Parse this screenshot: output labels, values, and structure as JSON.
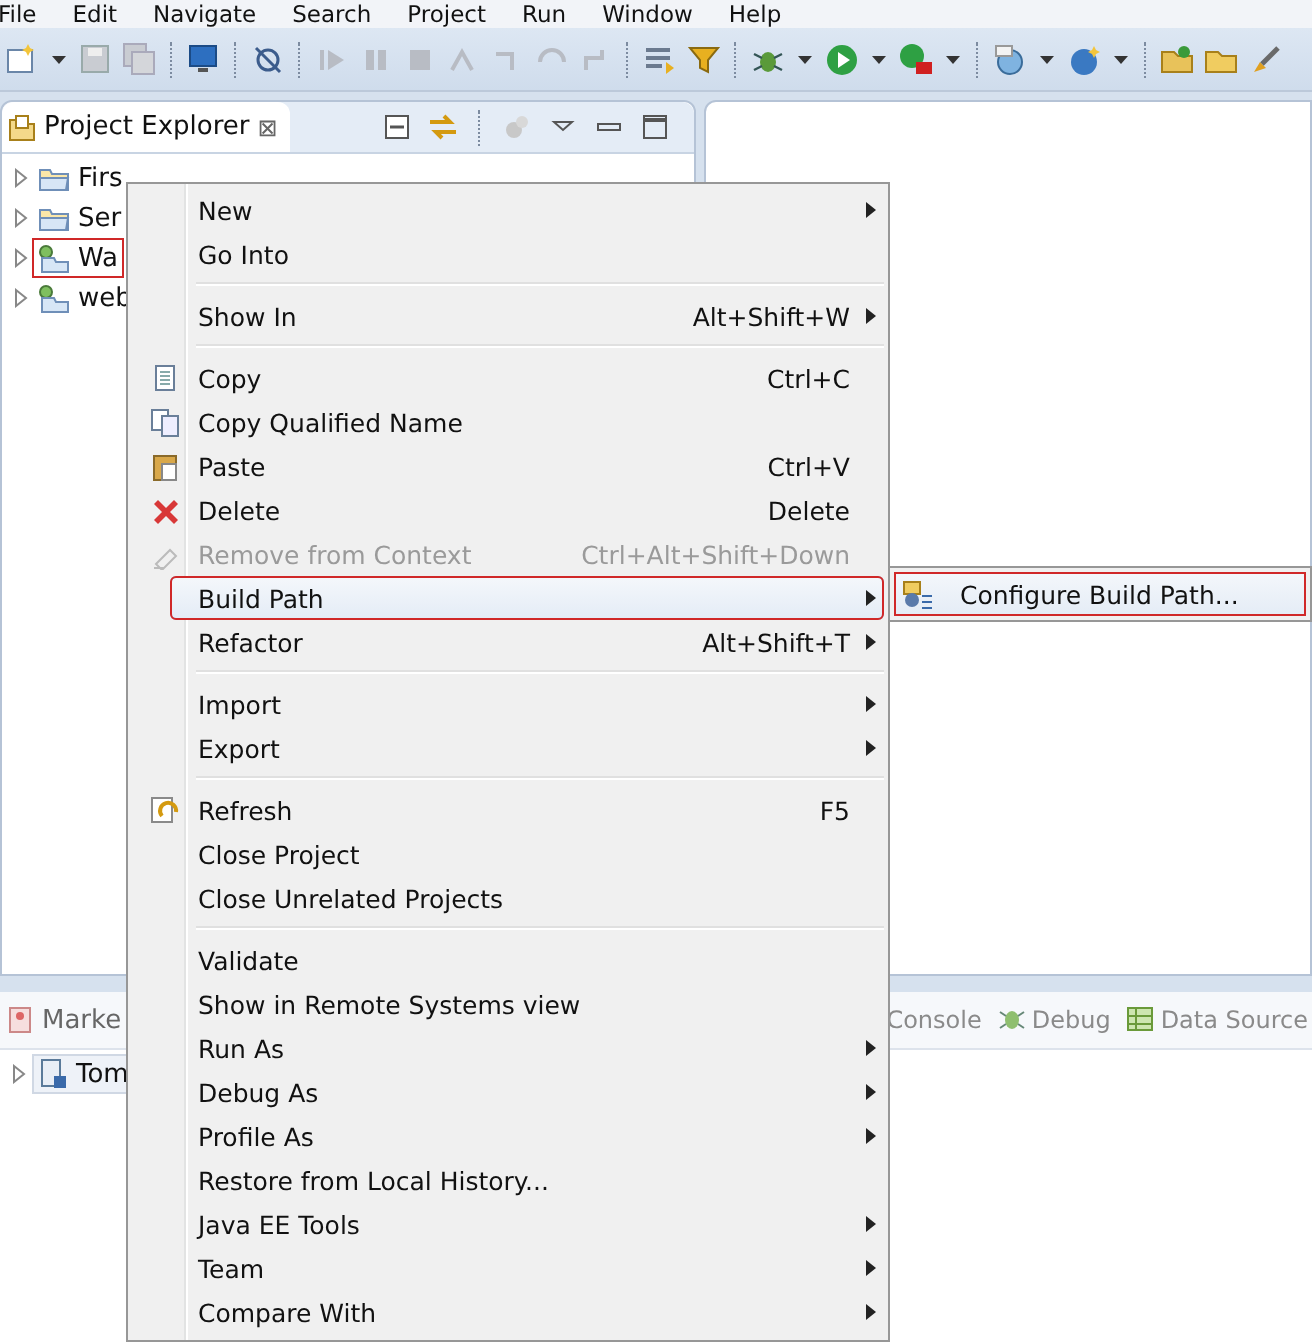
{
  "menu_bar": [
    "File",
    "Edit",
    "Navigate",
    "Search",
    "Project",
    "Run",
    "Window",
    "Help"
  ],
  "explorer": {
    "title": "Project Explorer",
    "close": "⊠",
    "items": [
      {
        "label": "Firs",
        "kind": "folder",
        "outlined": false
      },
      {
        "label": "Ser",
        "kind": "folder",
        "outlined": false
      },
      {
        "label": "Wa",
        "kind": "project",
        "outlined": true
      },
      {
        "label": "web",
        "kind": "project",
        "outlined": false
      }
    ]
  },
  "bottom_panel": {
    "left_tab": "Marke",
    "tree_item": "Tom",
    "right_tabs": [
      {
        "label": "Console",
        "kind": "console"
      },
      {
        "label": "Debug",
        "kind": "debug"
      },
      {
        "label": "Data Source",
        "kind": "data"
      }
    ]
  },
  "context_menu": [
    [
      {
        "label": "New",
        "submenu": true,
        "disabled": false,
        "selected": false,
        "outlined": false
      },
      {
        "label": "Go Into",
        "submenu": false,
        "disabled": false,
        "selected": false,
        "outlined": false
      }
    ],
    [
      {
        "label": "Show In",
        "shortcut": "Alt+Shift+W",
        "submenu": true,
        "disabled": false,
        "selected": false,
        "outlined": false
      }
    ],
    [
      {
        "label": "Copy",
        "shortcut": "Ctrl+C",
        "submenu": false,
        "disabled": false,
        "selected": false,
        "outlined": false
      },
      {
        "label": "Copy Qualified Name",
        "submenu": false,
        "disabled": false,
        "selected": false,
        "outlined": false
      },
      {
        "label": "Paste",
        "shortcut": "Ctrl+V",
        "submenu": false,
        "disabled": false,
        "selected": false,
        "outlined": false
      },
      {
        "label": "Delete",
        "shortcut": "Delete",
        "submenu": false,
        "disabled": false,
        "selected": false,
        "outlined": false
      },
      {
        "label": "Remove from Context",
        "shortcut": "Ctrl+Alt+Shift+Down",
        "submenu": false,
        "disabled": true,
        "selected": false,
        "outlined": false
      },
      {
        "label": "Build Path",
        "submenu": true,
        "disabled": false,
        "selected": true,
        "outlined": true
      },
      {
        "label": "Refactor",
        "shortcut": "Alt+Shift+T",
        "submenu": true,
        "disabled": false,
        "selected": false,
        "outlined": false
      }
    ],
    [
      {
        "label": "Import",
        "submenu": true,
        "disabled": false,
        "selected": false,
        "outlined": false
      },
      {
        "label": "Export",
        "submenu": true,
        "disabled": false,
        "selected": false,
        "outlined": false
      }
    ],
    [
      {
        "label": "Refresh",
        "shortcut": "F5",
        "submenu": false,
        "disabled": false,
        "selected": false,
        "outlined": false
      },
      {
        "label": "Close Project",
        "submenu": false,
        "disabled": false,
        "selected": false,
        "outlined": false
      },
      {
        "label": "Close Unrelated Projects",
        "submenu": false,
        "disabled": false,
        "selected": false,
        "outlined": false
      }
    ],
    [
      {
        "label": "Validate",
        "submenu": false,
        "disabled": false,
        "selected": false,
        "outlined": false
      },
      {
        "label": "Show in Remote Systems view",
        "submenu": false,
        "disabled": false,
        "selected": false,
        "outlined": false
      },
      {
        "label": "Run As",
        "submenu": true,
        "disabled": false,
        "selected": false,
        "outlined": false
      },
      {
        "label": "Debug As",
        "submenu": true,
        "disabled": false,
        "selected": false,
        "outlined": false
      },
      {
        "label": "Profile As",
        "submenu": true,
        "disabled": false,
        "selected": false,
        "outlined": false
      },
      {
        "label": "Restore from Local History...",
        "submenu": false,
        "disabled": false,
        "selected": false,
        "outlined": false
      },
      {
        "label": "Java EE Tools",
        "submenu": true,
        "disabled": false,
        "selected": false,
        "outlined": false
      },
      {
        "label": "Team",
        "submenu": true,
        "disabled": false,
        "selected": false,
        "outlined": false
      },
      {
        "label": "Compare With",
        "submenu": true,
        "disabled": false,
        "selected": false,
        "outlined": false
      }
    ]
  ],
  "submenu": [
    {
      "label": "Configure Build Path...",
      "outlined": true
    }
  ]
}
